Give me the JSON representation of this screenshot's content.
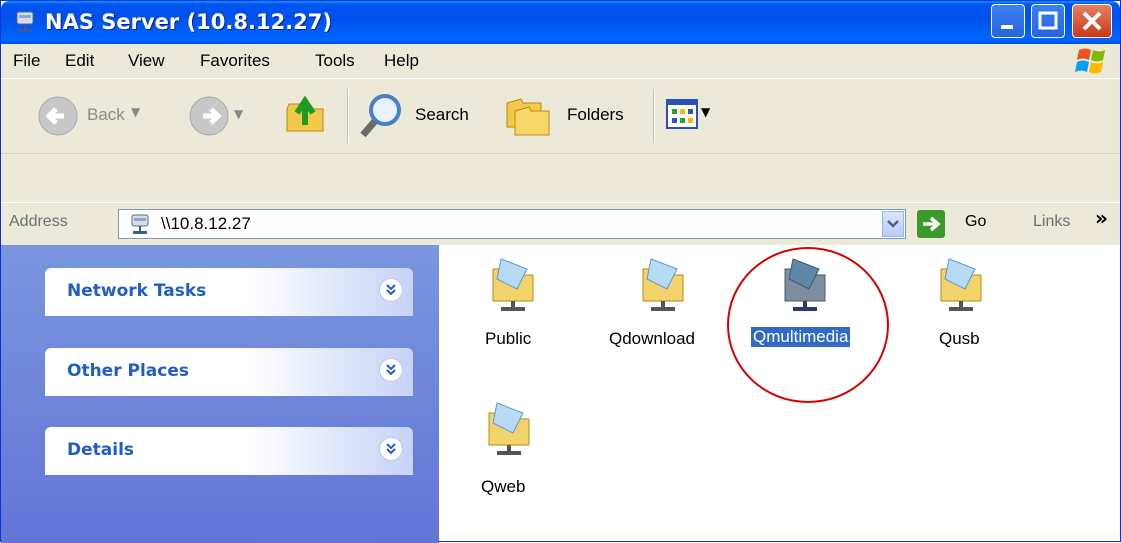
{
  "window": {
    "title": "NAS Server (10.8.12.27)",
    "icon": "network-drive-icon"
  },
  "menu": {
    "items": [
      "File",
      "Edit",
      "View",
      "Favorites",
      "Tools",
      "Help"
    ]
  },
  "toolbar": {
    "back_label": "Back",
    "search_label": "Search",
    "folders_label": "Folders"
  },
  "address": {
    "label": "Address",
    "value": "\\\\10.8.12.27",
    "go_label": "Go",
    "links_label": "Links",
    "more_glyph": "»"
  },
  "sidebar": {
    "panels": [
      {
        "title": "Network Tasks"
      },
      {
        "title": "Other Places"
      },
      {
        "title": "Details"
      }
    ]
  },
  "shares": [
    {
      "name": "Public",
      "selected": false
    },
    {
      "name": "Qdownload",
      "selected": false
    },
    {
      "name": "Qmultimedia",
      "selected": true
    },
    {
      "name": "Qusb",
      "selected": false
    },
    {
      "name": "Qweb",
      "selected": false
    }
  ],
  "colors": {
    "titlebar": "#0053ee",
    "sidebar": "#6f86db",
    "selection": "#316ac5",
    "highlight_circle": "#d80000"
  }
}
